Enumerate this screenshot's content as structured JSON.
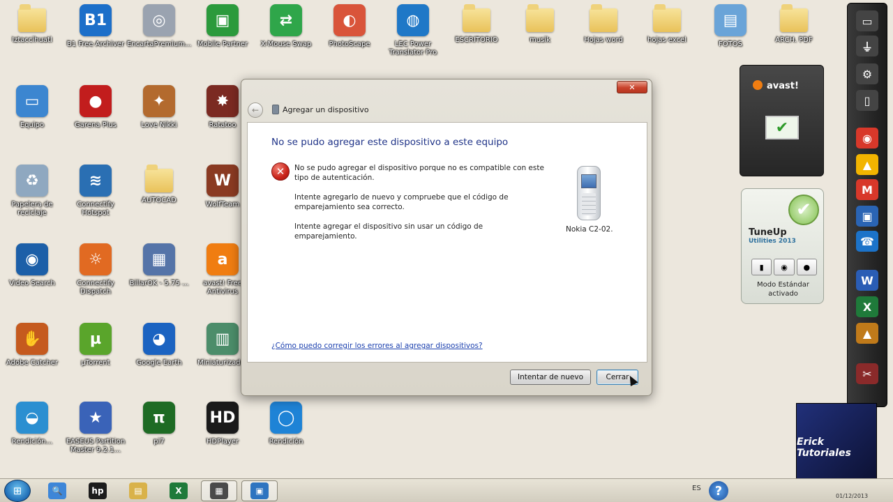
{
  "desktop": {
    "icons": [
      {
        "label": "Iztaccihuatl",
        "icon": "user-folder-icon",
        "glyph": "",
        "color": "#e9c25a",
        "kind": "folder"
      },
      {
        "label": "B1 Free Archiver",
        "icon": "b1-archiver-icon",
        "glyph": "B1",
        "color": "#1c6fc9",
        "kind": "app"
      },
      {
        "label": "EncartaPremium...",
        "icon": "disc-icon",
        "glyph": "◎",
        "color": "#9aa3b0",
        "kind": "app"
      },
      {
        "label": "Mobile Partner",
        "icon": "phone-app-icon",
        "glyph": "▣",
        "color": "#2b9a3c",
        "kind": "app"
      },
      {
        "label": "X-Mouse Swap",
        "icon": "arrows-icon",
        "glyph": "⇄",
        "color": "#2fa64a",
        "kind": "app"
      },
      {
        "label": "PhotoScape",
        "icon": "photoscape-icon",
        "glyph": "◐",
        "color": "#d9543a",
        "kind": "app"
      },
      {
        "label": "LEC Power Translator Pro",
        "icon": "globe-icon",
        "glyph": "◍",
        "color": "#1f78c7",
        "kind": "app"
      },
      {
        "label": "ESCRITORIO",
        "icon": "folder-icon",
        "glyph": "",
        "color": "#e9c25a",
        "kind": "folder"
      },
      {
        "label": "musik",
        "icon": "folder-icon",
        "glyph": "",
        "color": "#e9c25a",
        "kind": "folder"
      },
      {
        "label": "Hojas word",
        "icon": "folder-icon",
        "glyph": "",
        "color": "#e9c25a",
        "kind": "folder"
      },
      {
        "label": "hojas excel",
        "icon": "folder-icon",
        "glyph": "",
        "color": "#e9c25a",
        "kind": "folder"
      },
      {
        "label": "FOTOS",
        "icon": "photos-folder-icon",
        "glyph": "▤",
        "color": "#6aa4d8",
        "kind": "app"
      },
      {
        "label": "ARCH. PDF",
        "icon": "folder-icon",
        "glyph": "",
        "color": "#e9c25a",
        "kind": "folder"
      },
      {
        "label": "Equipo",
        "icon": "computer-icon",
        "glyph": "▭",
        "color": "#3c86d0",
        "kind": "app"
      },
      {
        "label": "Garena Plus",
        "icon": "garena-icon",
        "glyph": "●",
        "color": "#c21d1d",
        "kind": "app"
      },
      {
        "label": "Love Nikki",
        "icon": "game-icon",
        "glyph": "✦",
        "color": "#b36a2e",
        "kind": "app"
      },
      {
        "label": "Ratatoo",
        "icon": "game2-icon",
        "glyph": "✸",
        "color": "#7b2a22",
        "kind": "app"
      },
      {
        "label": "Papelera de reciclaje",
        "icon": "recycle-bin-icon",
        "glyph": "♻",
        "color": "#8fa8c0",
        "kind": "app"
      },
      {
        "label": "Connectify Hotspot",
        "icon": "wifi-icon",
        "glyph": "≋",
        "color": "#2a6fb3",
        "kind": "app"
      },
      {
        "label": "AUTOCAD",
        "icon": "folder-icon",
        "glyph": "",
        "color": "#e9c25a",
        "kind": "folder"
      },
      {
        "label": "WolfTeam",
        "icon": "wolfteam-icon",
        "glyph": "W",
        "color": "#8a3a22",
        "kind": "app"
      },
      {
        "label": "Video Search",
        "icon": "video-search-icon",
        "glyph": "◉",
        "color": "#1c5fa8",
        "kind": "app"
      },
      {
        "label": "Connectify Dispatch",
        "icon": "dispatch-icon",
        "glyph": "☼",
        "color": "#e16a22",
        "kind": "app"
      },
      {
        "label": "BillarOK - 5.75 ...",
        "icon": "installer-icon",
        "glyph": "▦",
        "color": "#5574a8",
        "kind": "app"
      },
      {
        "label": "avast! Free Antivirus",
        "icon": "avast-icon",
        "glyph": "a",
        "color": "#f07d11",
        "kind": "app"
      },
      {
        "label": "Adobe Catcher",
        "icon": "glove-icon",
        "glyph": "✋",
        "color": "#c55a1e",
        "kind": "app"
      },
      {
        "label": "µTorrent",
        "icon": "utorrent-icon",
        "glyph": "µ",
        "color": "#5aa52b",
        "kind": "app"
      },
      {
        "label": "Google Earth",
        "icon": "earth-icon",
        "glyph": "◕",
        "color": "#1b63c1",
        "kind": "app"
      },
      {
        "label": "Miniaturizador",
        "icon": "thumbnail-icon",
        "glyph": "▥",
        "color": "#4c8d6a",
        "kind": "app"
      },
      {
        "label": "Rendición...",
        "icon": "edge-icon",
        "glyph": "◒",
        "color": "#2b8fd1",
        "kind": "app"
      },
      {
        "label": "EASEUS Partition Master 9.2.1...",
        "icon": "partition-icon",
        "glyph": "★",
        "color": "#3a63b8",
        "kind": "app"
      },
      {
        "label": "pi7",
        "icon": "pi-icon",
        "glyph": "π",
        "color": "#1e6b24",
        "kind": "app"
      },
      {
        "label": "HDPlayer",
        "icon": "hd-player-icon",
        "glyph": "HD",
        "color": "#1a1a1a",
        "kind": "app"
      },
      {
        "label": "Rendición",
        "icon": "circle-app-icon",
        "glyph": "◯",
        "color": "#1e83d6",
        "kind": "app"
      }
    ]
  },
  "dialog": {
    "title": "Agregar un dispositivo",
    "close_glyph": "✕",
    "back_glyph": "←",
    "heading": "No se pudo agregar este dispositivo a este equipo",
    "error_glyph": "✕",
    "messages": [
      "No se pudo agregar el dispositivo porque no es compatible con este tipo de autenticación.",
      "Intente agregarlo de nuevo y compruebe que el código de emparejamiento sea correcto.",
      "Intente agregar el dispositivo sin usar un código de emparejamiento."
    ],
    "device_name": "Nokia C2-02.",
    "help_link": "¿Cómo puedo corregir los errores al agregar dispositivos?",
    "retry_button": "Intentar de nuevo",
    "close_button": "Cerrar"
  },
  "gadgets": {
    "avast_brand": "avast!",
    "avast_check": "✔",
    "tuneup_title": "TuneUp",
    "tuneup_subtitle": "Utilities 2013",
    "tuneup_check": "✔",
    "tuneup_mode": "Modo Estándar activado",
    "mode_glyphs": [
      "▮",
      "◉",
      "●"
    ]
  },
  "sidebar": {
    "items": [
      {
        "icon": "laptop-icon",
        "glyph": "▭",
        "color": "#444"
      },
      {
        "icon": "plug-icon",
        "glyph": "⏚",
        "color": "#444"
      },
      {
        "icon": "gear-icon",
        "glyph": "⚙",
        "color": "#444"
      },
      {
        "icon": "trash-icon",
        "glyph": "▯",
        "color": "#444"
      },
      {
        "icon": "chrome-icon",
        "glyph": "◉",
        "color": "#d8382a"
      },
      {
        "icon": "drive-icon",
        "glyph": "▲",
        "color": "#f2b400"
      },
      {
        "icon": "gmail-icon",
        "glyph": "M",
        "color": "#d8382a"
      },
      {
        "icon": "computer-icon",
        "glyph": "▣",
        "color": "#2a64b4"
      },
      {
        "icon": "phone-icon",
        "glyph": "☎",
        "color": "#1c73c9"
      },
      {
        "icon": "word-icon",
        "glyph": "W",
        "color": "#2a5db5"
      },
      {
        "icon": "excel-icon",
        "glyph": "X",
        "color": "#1f7a3a"
      },
      {
        "icon": "image-icon",
        "glyph": "▲",
        "color": "#c07a1a"
      },
      {
        "icon": "tool-icon",
        "glyph": "✂",
        "color": "#8a2a2a"
      }
    ]
  },
  "logo_text": "Erick Tutoriales",
  "taskbar": {
    "start_glyph": "⊞",
    "buttons": [
      {
        "icon": "search-icon",
        "glyph": "🔍",
        "color": "#3d86d8",
        "active": false
      },
      {
        "icon": "hp-icon",
        "glyph": "hp",
        "color": "#1c1c1c",
        "active": false
      },
      {
        "icon": "explorer-icon",
        "glyph": "▤",
        "color": "#d9b24a",
        "active": false
      },
      {
        "icon": "excel-icon",
        "glyph": "X",
        "color": "#1f7a3a",
        "active": false
      },
      {
        "icon": "devices-icon",
        "glyph": "▦",
        "color": "#4a4a4a",
        "active": true
      },
      {
        "icon": "window-icon",
        "glyph": "▣",
        "color": "#2e74c0",
        "active": true
      }
    ],
    "language": "ES",
    "help_glyph": "?",
    "date": "01/12/2013"
  }
}
